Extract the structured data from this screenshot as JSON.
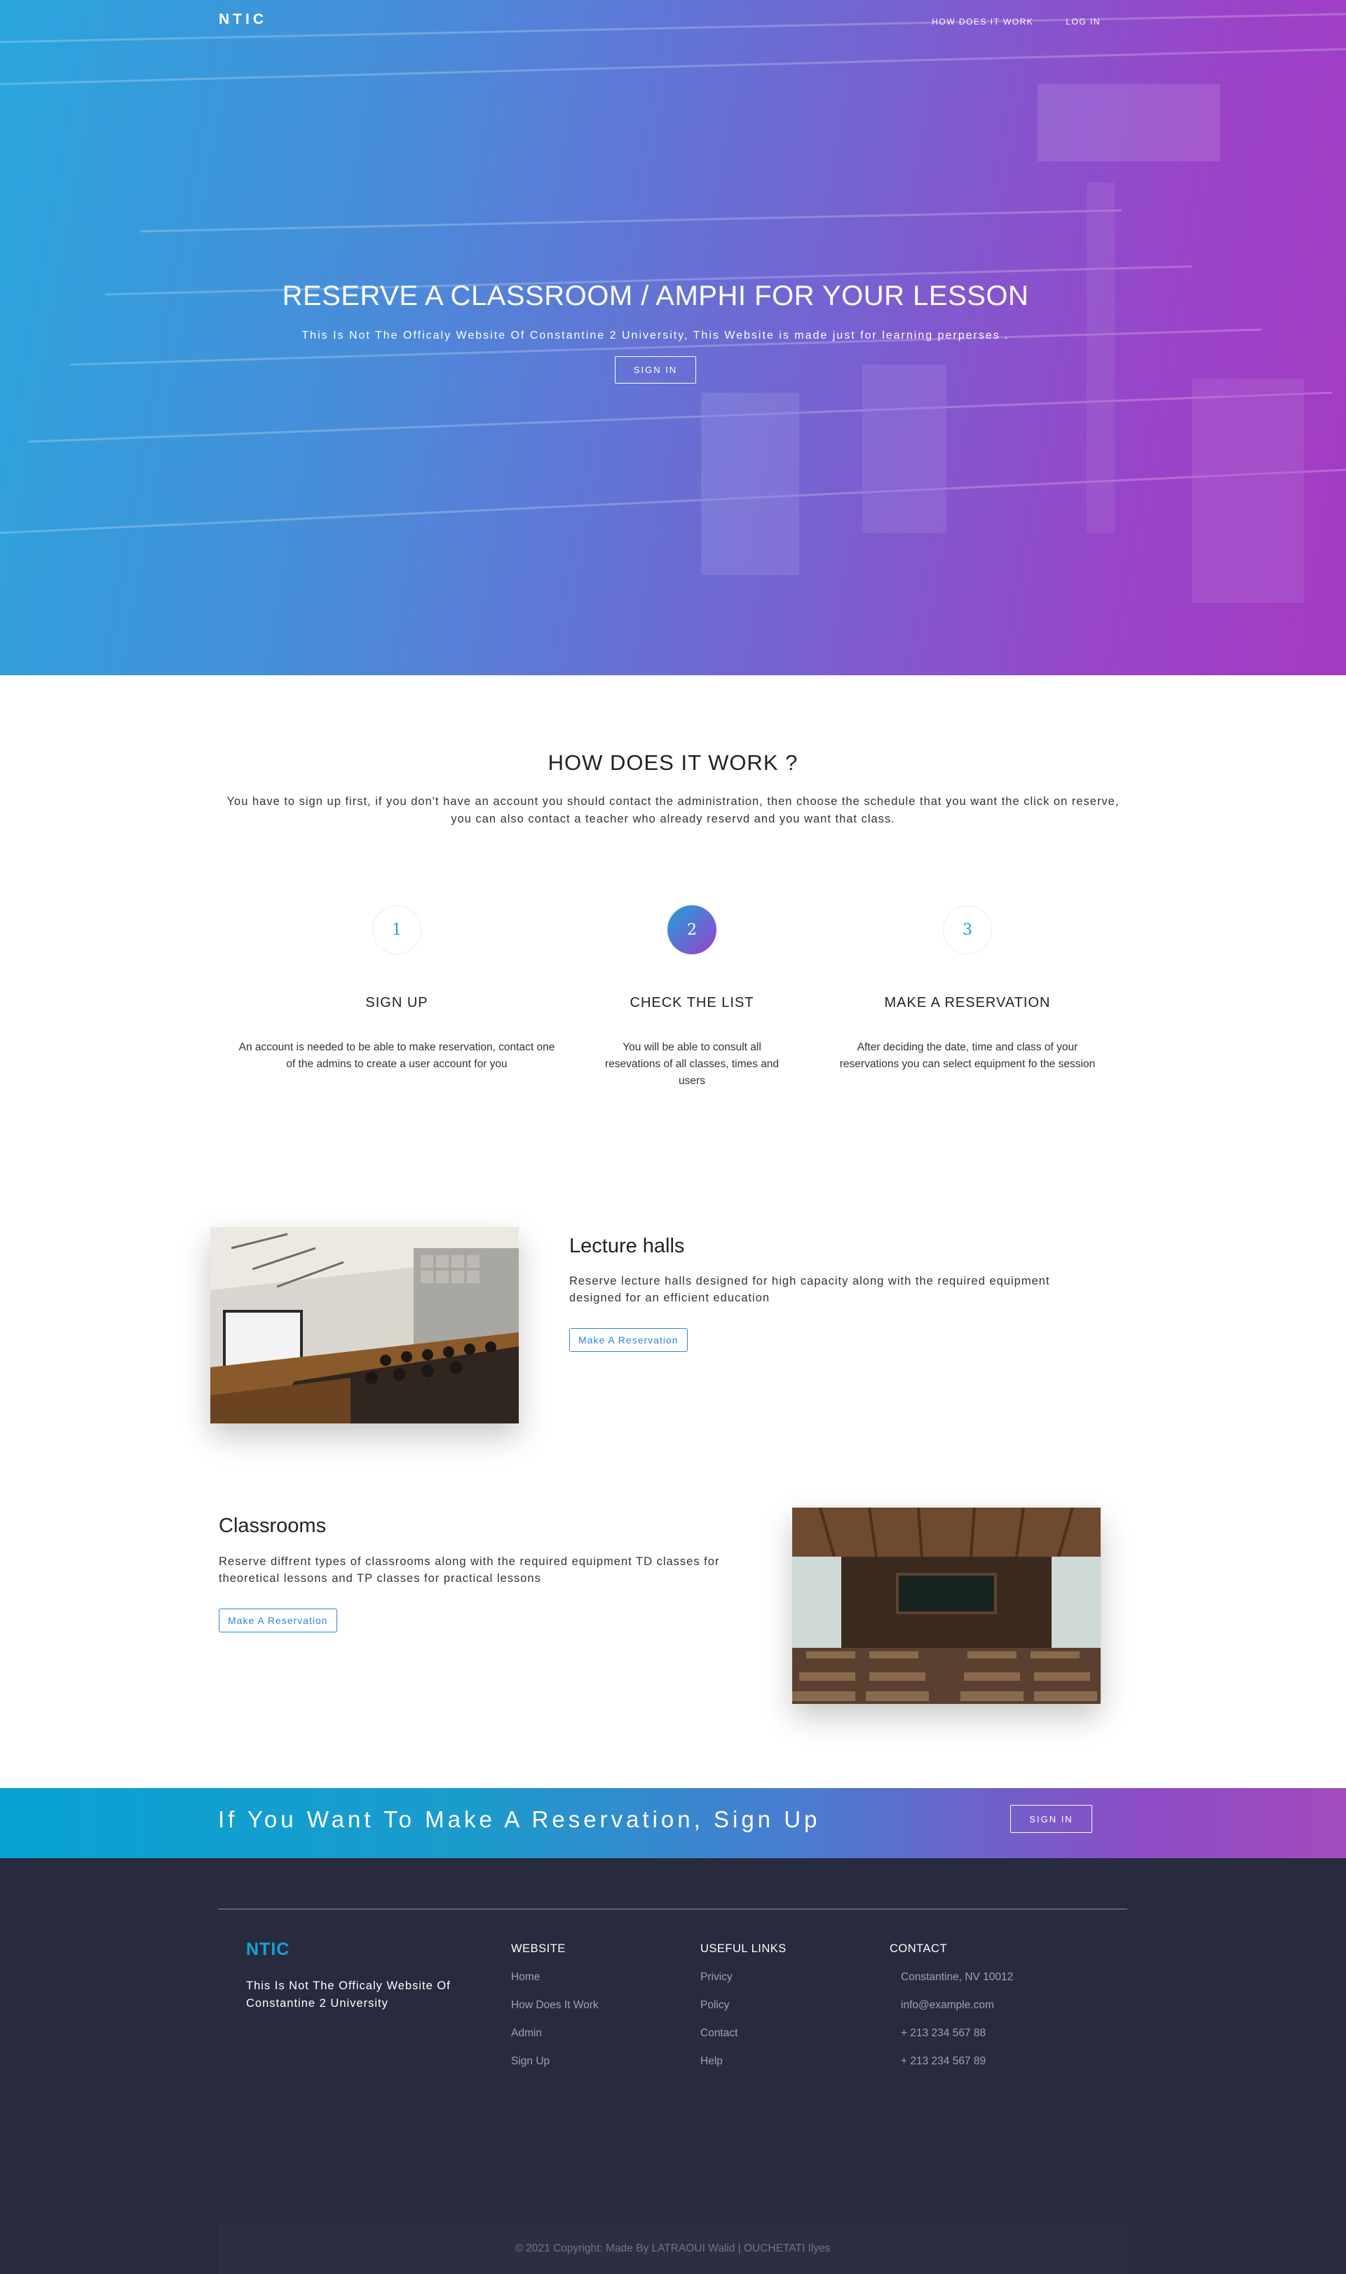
{
  "nav": {
    "logo": "NTIC",
    "links": [
      "HOW DOES IT WORK",
      "LOG IN"
    ]
  },
  "hero": {
    "title": "RESERVE A CLASSROOM / AMPHI FOR YOUR LESSON",
    "subtitle": "This Is Not The Officaly Website Of Constantine 2 University, This Website is made just for learning perperses .",
    "button": "SIGN IN"
  },
  "how": {
    "title": "HOW DOES IT WORK ?",
    "description": "You have to sign up first, if you don't have an account you should contact the administration, then choose the schedule that you want the click on reserve, you can also contact a teacher who already reservd and you want that class.",
    "steps": [
      {
        "number": "1",
        "title": "SIGN UP",
        "text": "An account is needed to be able to make reservation, contact one of the admins to create a user account for you"
      },
      {
        "number": "2",
        "title": "CHECK THE LIST",
        "text": "You will be able to consult all resevations of all classes, times and users"
      },
      {
        "number": "3",
        "title": "MAKE A RESERVATION",
        "text": "After deciding the date, time and class of your reservations you can select equipment fo the session"
      }
    ]
  },
  "features": [
    {
      "title": "Lecture halls",
      "text": "Reserve lecture halls designed for high capacity along with the required equipment designed for an efficient education",
      "button": "Make A Reservation"
    },
    {
      "title": "Classrooms",
      "text": "Reserve diffrent types of classrooms along with the required equipment TD classes for theoretical lessons and TP classes for practical lessons",
      "button": "Make A Reservation"
    }
  ],
  "cta": {
    "text": "If You Want To Make A Reservation, Sign Up",
    "button": "SIGN IN"
  },
  "footer": {
    "logo": "NTIC",
    "about": "This Is Not The Officaly Website Of Constantine 2 University",
    "website": {
      "heading": "WEBSITE",
      "links": [
        "Home",
        "How Does It Work",
        "Admin",
        "Sign Up"
      ]
    },
    "useful": {
      "heading": "USEFUL LINKS",
      "links": [
        "Privicy",
        "Policy",
        "Contact",
        "Help"
      ]
    },
    "contact": {
      "heading": "CONTACT",
      "lines": [
        "Constantine, NV 10012",
        "info@example.com",
        "+ 213 234 567 88",
        "+ 213 234 567 89"
      ]
    },
    "copyright": "© 2021 Copyright: Made By LATRAOUI Walid | OUCHETATI Ilyes"
  },
  "colors": {
    "accent_blue": "#1aa0d8",
    "accent_purple": "#9b3fca",
    "button_blue": "#2f84d7",
    "footer_bg": "#282b3e"
  }
}
